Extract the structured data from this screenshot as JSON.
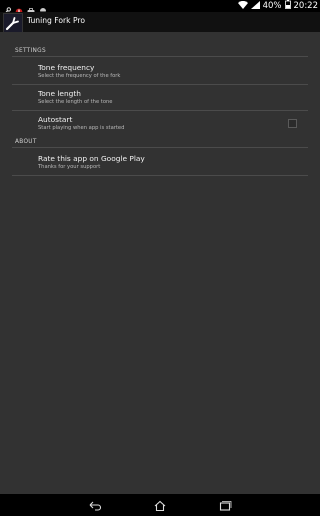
{
  "status_bar": {
    "battery": "40%",
    "time": "20:22",
    "icons": [
      "wrench-icon",
      "alert-icon",
      "briefcase-icon",
      "android-icon",
      "wifi-icon",
      "signal-icon",
      "battery-icon"
    ]
  },
  "action_bar": {
    "title": "Tuning Fork Pro",
    "icon": "tuning-fork-icon"
  },
  "settings": {
    "category_settings": "SETTINGS",
    "tone_frequency": {
      "title": "Tone frequency",
      "summary": "Select the frequency of the fork"
    },
    "tone_length": {
      "title": "Tone length",
      "summary": "Select the length of the tone"
    },
    "autostart": {
      "title": "Autostart",
      "summary": "Start playing when app is started",
      "checked": false
    },
    "category_about": "ABOUT",
    "rate": {
      "title": "Rate this app on Google Play",
      "summary": "Thanks for your support"
    }
  },
  "nav_bar": {
    "icons": [
      "back-icon",
      "home-icon",
      "recents-icon"
    ]
  }
}
